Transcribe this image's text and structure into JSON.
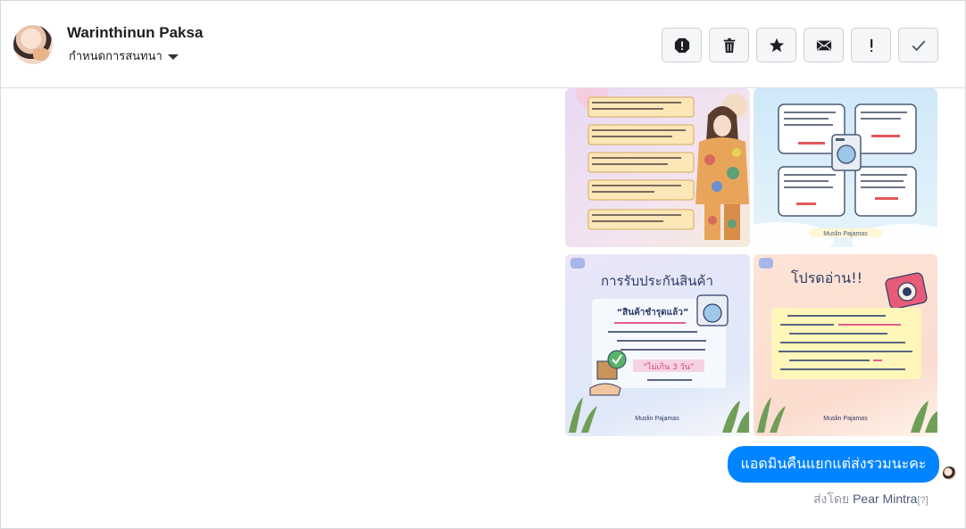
{
  "header": {
    "name": "Warinthinun Paksa",
    "subtitle": "กำหนดการสนทนา"
  },
  "actions": [
    {
      "icon": "alert-octagon-icon"
    },
    {
      "icon": "trash-icon"
    },
    {
      "icon": "star-icon"
    },
    {
      "icon": "envelope-icon"
    },
    {
      "icon": "exclamation-icon"
    },
    {
      "icon": "check-icon"
    }
  ],
  "images": {
    "img3_title": "การรับประกันสินค้า",
    "img3_badge": "“สินค้าชำรุดแล้ว”",
    "img3_highlight": "“ไม่เกิน 3 วัน”",
    "img3_brand": "Muslin Pajamas",
    "img4_title": "โปรดอ่าน!!",
    "img4_brand": "Muslin Pajamas",
    "img2_brand": "Muslin Pajamas"
  },
  "message": {
    "text": "แอดมินคืนแยกแต่ส่งรวมนะคะ",
    "sent_by_prefix": "ส่งโดย",
    "sent_by_name": "Pear Mintra",
    "sent_by_help": "[?]"
  },
  "colors": {
    "bubble": "#0084ff",
    "border": "#dadde1"
  }
}
